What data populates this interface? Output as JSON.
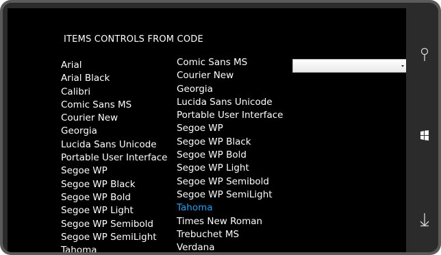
{
  "page": {
    "title": "ITEMS CONTROLS FROM CODE"
  },
  "list_a": {
    "items": [
      "Arial",
      "Arial Black",
      "Calibri",
      "Comic Sans MS",
      "Courier New",
      "Georgia",
      "Lucida Sans Unicode",
      "Portable User Interface",
      "Segoe WP",
      "Segoe WP Black",
      "Segoe WP Bold",
      "Segoe WP Light",
      "Segoe WP Semibold",
      "Segoe WP SemiLight",
      "Tahoma"
    ]
  },
  "list_b": {
    "items": [
      "Comic Sans MS",
      "Courier New",
      "Georgia",
      "Lucida Sans Unicode",
      "Portable User Interface",
      "Segoe WP",
      "Segoe WP Black",
      "Segoe WP Bold",
      "Segoe WP Light",
      "Segoe WP Semibold",
      "Segoe WP SemiLight",
      "Tahoma",
      "Times New Roman",
      "Trebuchet MS",
      "Verdana"
    ],
    "selected": "Tahoma"
  },
  "combo": {
    "value": ""
  },
  "hardware_buttons": {
    "search": "search-icon",
    "start": "windows-logo-icon",
    "back": "back-arrow-icon"
  },
  "colors": {
    "accent": "#2f9ef0",
    "background": "#000000",
    "text": "#ffffff"
  }
}
